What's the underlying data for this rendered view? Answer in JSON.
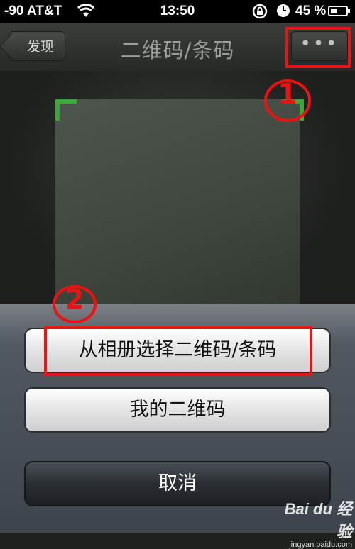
{
  "status_bar": {
    "carrier": "-90 AT&T",
    "time": "13:50",
    "battery": "45 %",
    "battery_level": 0.45,
    "icons": [
      "wifi-icon",
      "rotation-lock-icon",
      "alarm-icon",
      "battery-icon"
    ]
  },
  "nav": {
    "back_label": "发现",
    "title": "二维码/条码",
    "more_label": "•••"
  },
  "annotations": {
    "step1": "1",
    "step2": "2",
    "color": "#e11111"
  },
  "action_sheet": {
    "album_label": "从相册选择二维码/条码",
    "my_qr_label": "我的二维码",
    "cancel_label": "取消"
  },
  "watermark": {
    "brand": "Bai du 经验",
    "site": "jingyan.baidu.com"
  },
  "colors": {
    "scan_corner": "#3ca83a"
  }
}
